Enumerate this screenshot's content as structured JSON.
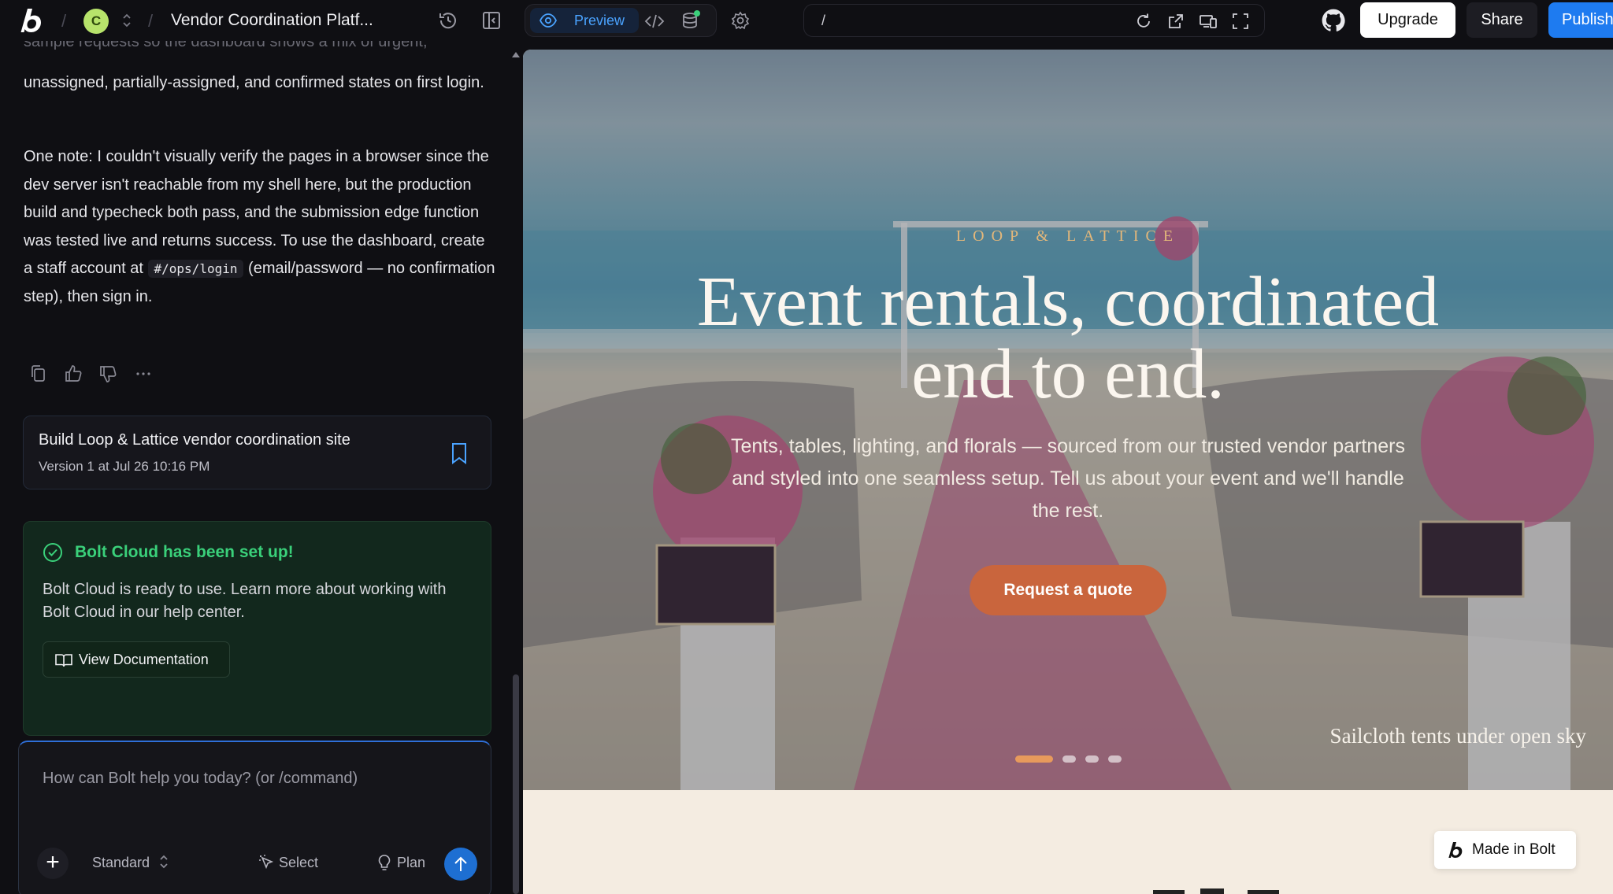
{
  "topbar": {
    "project_initial": "C",
    "project_title": "Vendor Coordination Platf...",
    "preview_label": "Preview",
    "url_path": "/",
    "upgrade_label": "Upgrade",
    "share_label": "Share",
    "publish_label": "Publish"
  },
  "chat": {
    "faded_line": "sample requests so the dashboard shows a mix of urgent,",
    "para1": "unassigned, partially-assigned, and confirmed states on first login.",
    "para2_a": "One note: I couldn't visually verify the pages in a browser since the dev server isn't reachable from my shell here, but the production build and typecheck both pass, and the submission edge function was tested live and returns success. To use the dashboard, create a staff account at",
    "para2_code": "#/ops/login",
    "para2_b": "(email/password — no confirmation step), then sign in.",
    "version_title": "Build Loop & Lattice vendor coordination site",
    "version_sub": "Version 1 at Jul 26 10:16 PM",
    "cloud_title": "Bolt Cloud has been set up!",
    "cloud_body": "Bolt Cloud is ready to use. Learn more about working with Bolt Cloud in our help center.",
    "cloud_button": "View Documentation",
    "input_placeholder": "How can Bolt help you today? (or /command)",
    "mode_label": "Standard",
    "select_label": "Select",
    "plan_label": "Plan"
  },
  "preview": {
    "eyebrow": "LOOP & LATTICE",
    "title_line1": "Event rentals, coordinated",
    "title_line2": "end to end.",
    "subtitle": "Tents, tables, lighting, and florals — sourced from our trusted vendor partners and styled into one seamless setup. Tell us about your event and we'll handle the rest.",
    "cta_label": "Request a quote",
    "slide_caption": "Sailcloth tents under open sky",
    "slide_count": 4,
    "active_slide": 1,
    "badge_label": "Made in Bolt"
  },
  "colors": {
    "accent_blue": "#1e7bf0",
    "success_green": "#3ad07a",
    "cta_orange": "#c9653d",
    "avatar_green": "#b7e36b"
  }
}
